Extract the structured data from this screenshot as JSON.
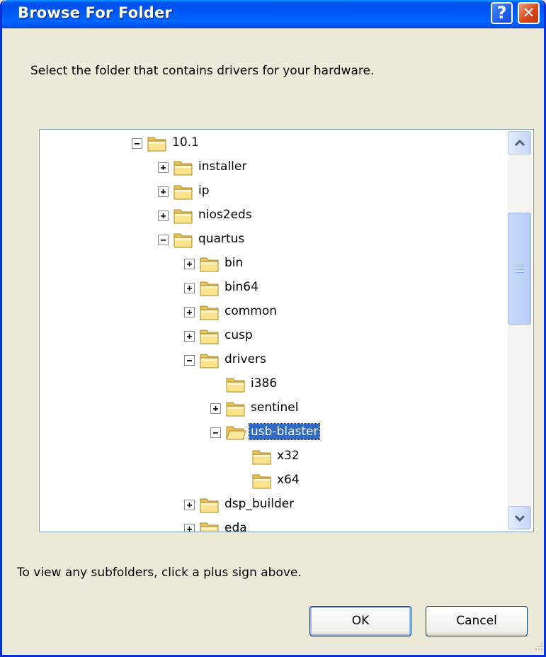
{
  "window": {
    "title": "Browse For Folder",
    "help_glyph": "?",
    "close_glyph": "✕"
  },
  "prompt": "Select the folder that contains drivers for your hardware.",
  "tree": {
    "items": [
      {
        "label": "10.1",
        "level": 0,
        "state": "expanded",
        "selected": false
      },
      {
        "label": "installer",
        "level": 1,
        "state": "collapsed",
        "selected": false
      },
      {
        "label": "ip",
        "level": 1,
        "state": "collapsed",
        "selected": false
      },
      {
        "label": "nios2eds",
        "level": 1,
        "state": "collapsed",
        "selected": false
      },
      {
        "label": "quartus",
        "level": 1,
        "state": "expanded",
        "selected": false
      },
      {
        "label": "bin",
        "level": 2,
        "state": "collapsed",
        "selected": false
      },
      {
        "label": "bin64",
        "level": 2,
        "state": "collapsed",
        "selected": false
      },
      {
        "label": "common",
        "level": 2,
        "state": "collapsed",
        "selected": false
      },
      {
        "label": "cusp",
        "level": 2,
        "state": "collapsed",
        "selected": false
      },
      {
        "label": "drivers",
        "level": 2,
        "state": "expanded",
        "selected": false
      },
      {
        "label": "i386",
        "level": 3,
        "state": "none",
        "selected": false
      },
      {
        "label": "sentinel",
        "level": 3,
        "state": "collapsed",
        "selected": false
      },
      {
        "label": "usb-blaster",
        "level": 3,
        "state": "expanded",
        "selected": true
      },
      {
        "label": "x32",
        "level": 4,
        "state": "none",
        "selected": false
      },
      {
        "label": "x64",
        "level": 4,
        "state": "none",
        "selected": false
      },
      {
        "label": "dsp_builder",
        "level": 2,
        "state": "collapsed",
        "selected": false
      },
      {
        "label": "eda",
        "level": 2,
        "state": "collapsed",
        "selected": false
      }
    ],
    "icons": {
      "folder": "folder-icon",
      "open_folder": "open-folder-icon",
      "expand": "plus-box-icon",
      "collapse": "minus-box-icon"
    }
  },
  "hint": "To view any subfolders, click a plus sign above.",
  "buttons": {
    "ok": "OK",
    "cancel": "Cancel"
  },
  "colors": {
    "titlebar": "#0058ee",
    "selection": "#316ac5",
    "dialog_bg": "#ece9d8",
    "folder": "#f7d774"
  }
}
